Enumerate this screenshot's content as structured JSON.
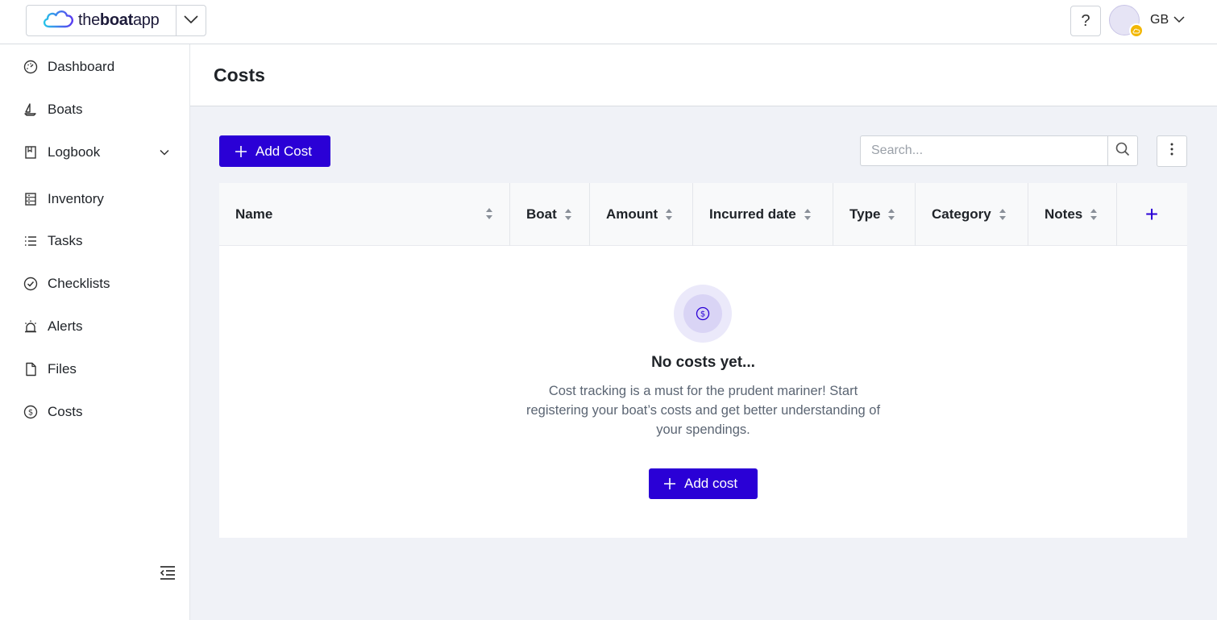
{
  "app": {
    "logo_prefix": "the",
    "logo_bold": "boat",
    "logo_suffix": "app",
    "help_label": "?",
    "user_initials": "GB"
  },
  "sidebar": {
    "items": [
      {
        "label": "Dashboard",
        "icon": "gauge-icon"
      },
      {
        "label": "Boats",
        "icon": "sailboat-icon"
      },
      {
        "label": "Logbook",
        "icon": "book-icon",
        "expandable": true
      },
      {
        "label": "Inventory",
        "icon": "inventory-icon"
      },
      {
        "label": "Tasks",
        "icon": "list-icon"
      },
      {
        "label": "Checklists",
        "icon": "check-circle-icon"
      },
      {
        "label": "Alerts",
        "icon": "siren-icon"
      },
      {
        "label": "Files",
        "icon": "file-icon"
      },
      {
        "label": "Costs",
        "icon": "dollar-circle-icon"
      }
    ]
  },
  "page": {
    "title": "Costs",
    "add_button": "Add Cost",
    "search_placeholder": "Search..."
  },
  "table": {
    "columns": [
      "Name",
      "Boat",
      "Amount",
      "Incurred date",
      "Type",
      "Category",
      "Notes"
    ],
    "add_column_label": "+"
  },
  "empty_state": {
    "title": "No costs yet...",
    "description": "Cost tracking is a must for the prudent mariner! Start registering your boat’s costs and get better understanding of your spendings.",
    "button": "Add cost"
  },
  "colors": {
    "primary": "#2a00d6",
    "background": "#f0f2f7",
    "badge": "#f2b705"
  }
}
